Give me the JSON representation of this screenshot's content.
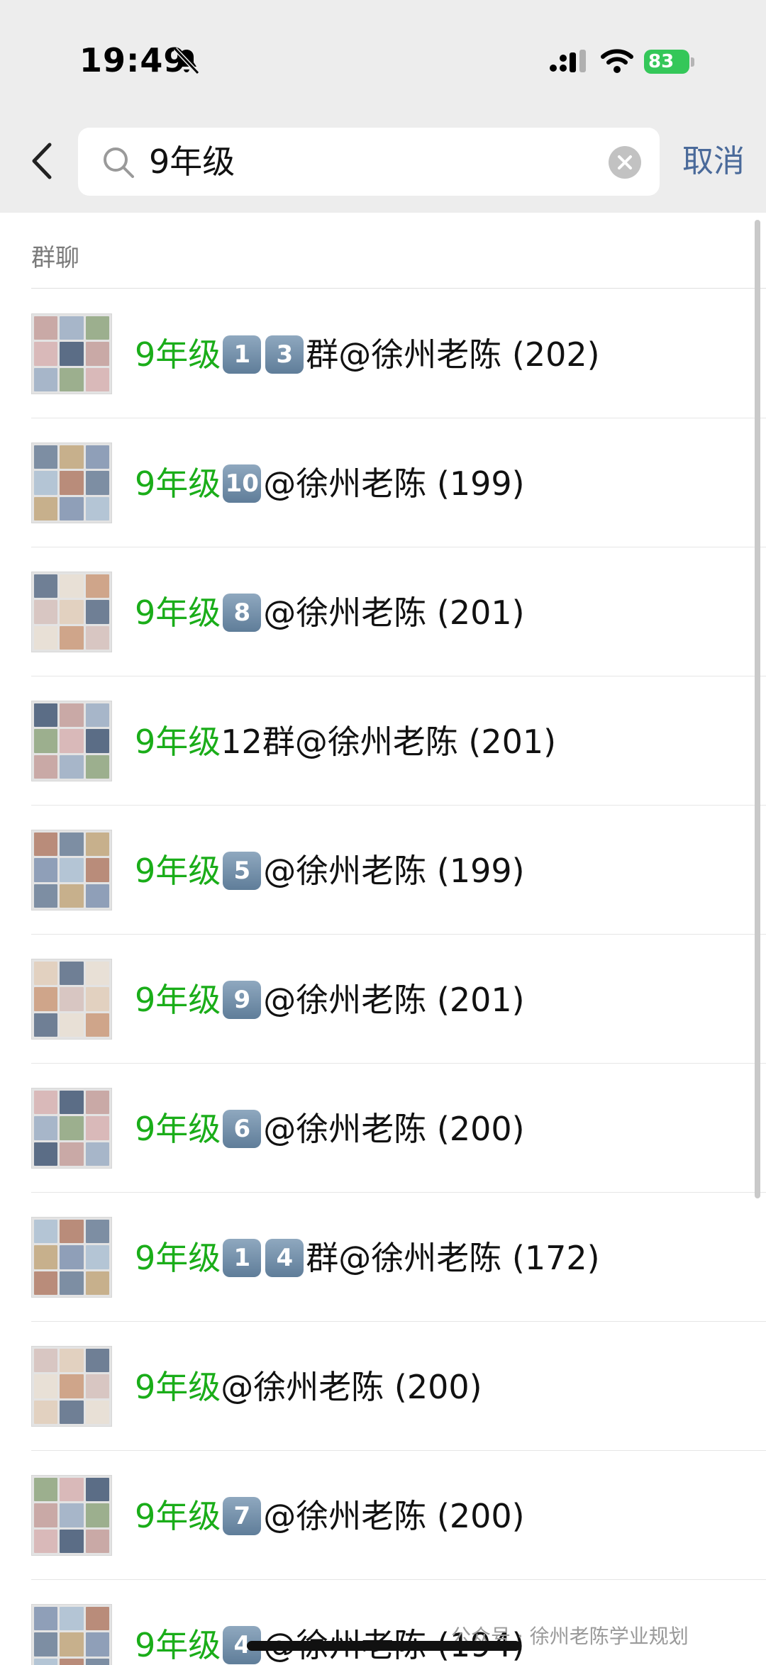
{
  "status": {
    "time": "19:49",
    "battery": "83"
  },
  "search": {
    "query": "9年级",
    "cancel_label": "取消"
  },
  "section": {
    "title": "群聊"
  },
  "results": [
    {
      "highlight": "9年级",
      "parts": [
        {
          "k": "1"
        },
        {
          "k": "3"
        },
        {
          "t": " 群@徐州老陈 (202)"
        }
      ]
    },
    {
      "highlight": "9年级",
      "parts": [
        {
          "k": "10"
        },
        {
          "t": "@徐州老陈 (199)"
        }
      ]
    },
    {
      "highlight": "9年级",
      "parts": [
        {
          "k": "8"
        },
        {
          "t": "@徐州老陈 (201)"
        }
      ]
    },
    {
      "highlight": "9年级",
      "parts": [
        {
          "t": "12群@徐州老陈 (201)"
        }
      ]
    },
    {
      "highlight": "9年级",
      "parts": [
        {
          "k": "5"
        },
        {
          "t": "@徐州老陈 (199)"
        }
      ]
    },
    {
      "highlight": "9年级",
      "parts": [
        {
          "k": "9"
        },
        {
          "t": "@徐州老陈 (201)"
        }
      ]
    },
    {
      "highlight": "9年级",
      "parts": [
        {
          "k": "6"
        },
        {
          "t": "@徐州老陈 (200)"
        }
      ]
    },
    {
      "highlight": "9年级",
      "parts": [
        {
          "k": "1"
        },
        {
          "k": "4"
        },
        {
          "t": "群@徐州老陈 (172)"
        }
      ]
    },
    {
      "highlight": "9年级",
      "parts": [
        {
          "t": "@徐州老陈 (200)"
        }
      ]
    },
    {
      "highlight": "9年级",
      "parts": [
        {
          "k": "7"
        },
        {
          "t": "@徐州老陈 (200)"
        }
      ]
    },
    {
      "highlight": "9年级",
      "parts": [
        {
          "k": "4"
        },
        {
          "t": "@徐州老陈 (194)"
        }
      ]
    }
  ],
  "watermark": "公众号 · 徐州老陈学业规划",
  "avatar_palette": [
    "#c9a9a6",
    "#b98c7a",
    "#d8c6c2",
    "#a7b6c9",
    "#7d8ea3",
    "#e2d1c0",
    "#9caf8e",
    "#c7b08c",
    "#6f7f95",
    "#d9b9b9",
    "#8f9fb8",
    "#e8e0d6",
    "#5b6d86",
    "#b4c5d5",
    "#cfa58a"
  ],
  "colors": {
    "highlight": "#1aad19",
    "cancel": "#4a6a9a",
    "battery": "#34c759",
    "top_bg": "#ededed"
  }
}
